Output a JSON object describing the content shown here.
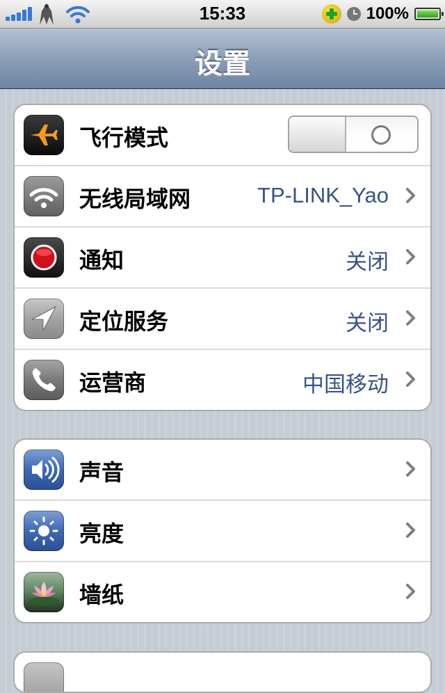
{
  "status_bar": {
    "time": "15:33",
    "battery_text": "100%",
    "signal_bars": 5,
    "battery_level": 1.0,
    "icons": [
      "signal-icon",
      "carrier-logo-icon",
      "wifi-icon",
      "qq-icon",
      "alarm-icon",
      "battery-icon"
    ]
  },
  "nav": {
    "title": "设置"
  },
  "groups": [
    {
      "rows": [
        {
          "label": "飞行模式",
          "icon": "airplane-icon",
          "control": "toggle",
          "toggle_on": false
        },
        {
          "label": "无线局域网",
          "icon": "wifi-icon",
          "value": "TP-LINK_Yao",
          "icon_name": "chevron-right-icon"
        },
        {
          "label": "通知",
          "icon": "notification-icon",
          "value": "关闭",
          "icon_name": "chevron-right-icon"
        },
        {
          "label": "定位服务",
          "icon": "location-icon",
          "value": "关闭",
          "icon_name": "chevron-right-icon"
        },
        {
          "label": "运营商",
          "icon": "phone-icon",
          "value": "中国移动",
          "icon_name": "chevron-right-icon"
        }
      ]
    },
    {
      "rows": [
        {
          "label": "声音",
          "icon": "speaker-icon",
          "icon_name": "chevron-right-icon"
        },
        {
          "label": "亮度",
          "icon": "sun-icon",
          "icon_name": "chevron-right-icon"
        },
        {
          "label": "墙纸",
          "icon": "wallpaper-icon",
          "icon_name": "chevron-right-icon"
        }
      ]
    }
  ],
  "colors": {
    "value_text": "#385487",
    "nav_gradient_top": "#b4c1d2",
    "nav_gradient_bottom": "#6e84a3",
    "background": "#c5ccd4"
  }
}
